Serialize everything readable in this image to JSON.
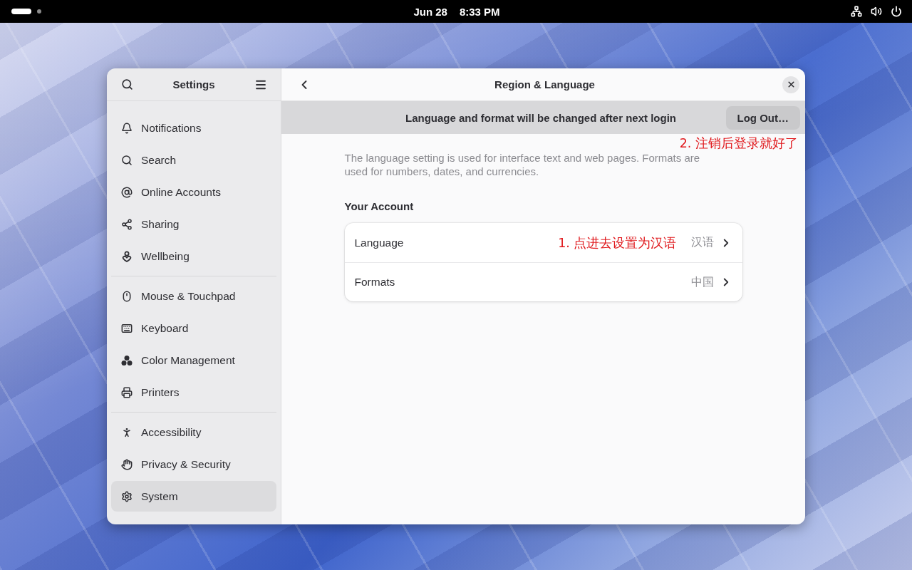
{
  "top_bar": {
    "workspaces": [
      {
        "selected": true
      },
      {
        "selected": false
      }
    ],
    "date": "Jun 28",
    "time": "8:33 PM"
  },
  "window": {
    "sidebar": {
      "title": "Settings",
      "groups": [
        {
          "items": [
            {
              "label": "Notifications",
              "selected": false
            },
            {
              "label": "Search",
              "selected": false
            },
            {
              "label": "Online Accounts",
              "selected": false
            },
            {
              "label": "Sharing",
              "selected": false
            },
            {
              "label": "Wellbeing",
              "selected": false
            }
          ]
        },
        {
          "items": [
            {
              "label": "Mouse & Touchpad",
              "selected": false
            },
            {
              "label": "Keyboard",
              "selected": false
            },
            {
              "label": "Color Management",
              "selected": false
            },
            {
              "label": "Printers",
              "selected": false
            }
          ]
        },
        {
          "items": [
            {
              "label": "Accessibility",
              "selected": false
            },
            {
              "label": "Privacy & Security",
              "selected": false
            },
            {
              "label": "System",
              "selected": true
            }
          ]
        }
      ]
    },
    "page": {
      "title": "Region & Language",
      "banner": {
        "message": "Language and format will be changed after next login",
        "button": "Log Out…",
        "annotation": "2. 注销后登录就好了"
      },
      "description": "The language setting is used for interface text and web pages. Formats are used for numbers, dates, and currencies.",
      "section": {
        "heading": "Your Account",
        "rows": [
          {
            "label": "Language",
            "value": "汉语",
            "annotation": "1. 点进去设置为汉语"
          },
          {
            "label": "Formats",
            "value": "中国"
          }
        ]
      }
    }
  }
}
